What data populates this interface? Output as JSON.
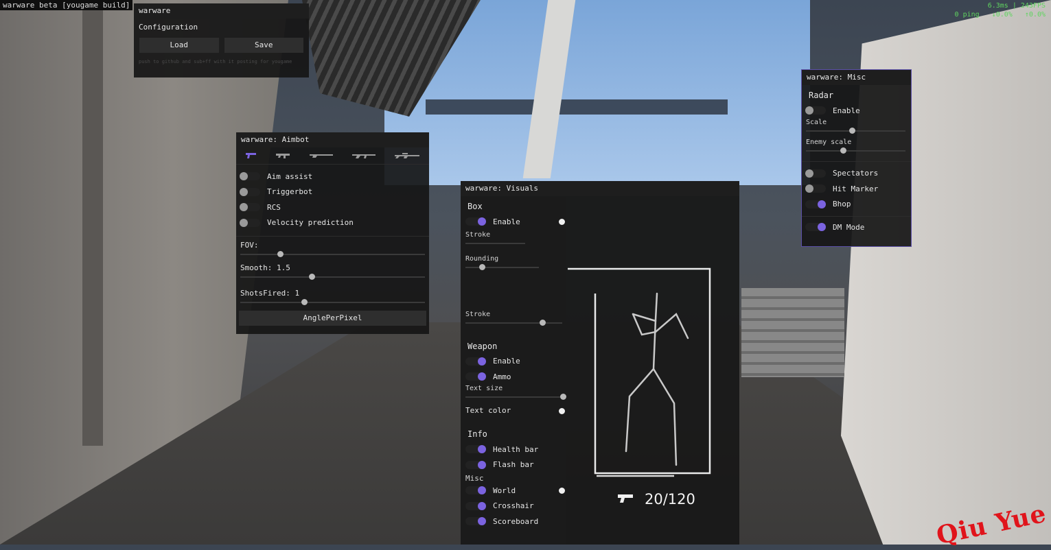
{
  "hud": {
    "top_left": "warware beta [yougame build]",
    "perf_line1": "6.3ms | 243FPS",
    "ping": "0 ping",
    "loss_down": "↓0.0%",
    "loss_up": "↑0.0%"
  },
  "watermark": "Qiu Yue",
  "config": {
    "title": "warware",
    "subtitle": "Configuration",
    "load_label": "Load",
    "save_label": "Save",
    "note": "push to github and sub+ff with it posting for yougame"
  },
  "aimbot": {
    "title": "warware: Aimbot",
    "weapon_icons": [
      "pistol-icon",
      "smg-icon",
      "shotgun-icon",
      "rifle-icon",
      "sniper-icon"
    ],
    "toggles": [
      {
        "label": "Aim assist",
        "on": false
      },
      {
        "label": "Triggerbot",
        "on": false
      },
      {
        "label": "RCS",
        "on": false
      },
      {
        "label": "Velocity prediction",
        "on": false
      }
    ],
    "fov_label": "FOV:",
    "fov_level": 0.22,
    "smooth_label": "Smooth: 1.5",
    "smooth_level": 0.39,
    "shots_label": "ShotsFired: 1",
    "shots_level": 0.35,
    "button_label": "AnglePerPixel"
  },
  "visuals": {
    "title": "warware: Visuals",
    "box_section": "Box",
    "box_enable": "Enable",
    "stroke_label": "Stroke",
    "rounding_label": "Rounding",
    "stroke2_label": "Stroke",
    "stroke2_level": 0.8,
    "weapon_section": "Weapon",
    "weapon_enable": "Enable",
    "ammo_label": "Ammo",
    "text_size_label": "Text size",
    "text_size_level": 1.0,
    "text_color_label": "Text color",
    "info_section": "Info",
    "health_bar": "Health bar",
    "flash_bar": "Flash bar",
    "misc_section": "Misc",
    "world_label": "World",
    "crosshair_label": "Crosshair",
    "scoreboard_label": "Scoreboard",
    "ammo_counter": "20/120"
  },
  "misc": {
    "title": "warware: Misc",
    "radar_section": "Radar",
    "radar_enable": "Enable",
    "scale_label": "Scale",
    "scale_level": 0.47,
    "enemy_scale_label": "Enemy scale",
    "enemy_scale_level": 0.38,
    "spectators_label": "Spectators",
    "hit_marker_label": "Hit Marker",
    "bhop_label": "Bhop",
    "dm_mode_label": "DM Mode"
  }
}
